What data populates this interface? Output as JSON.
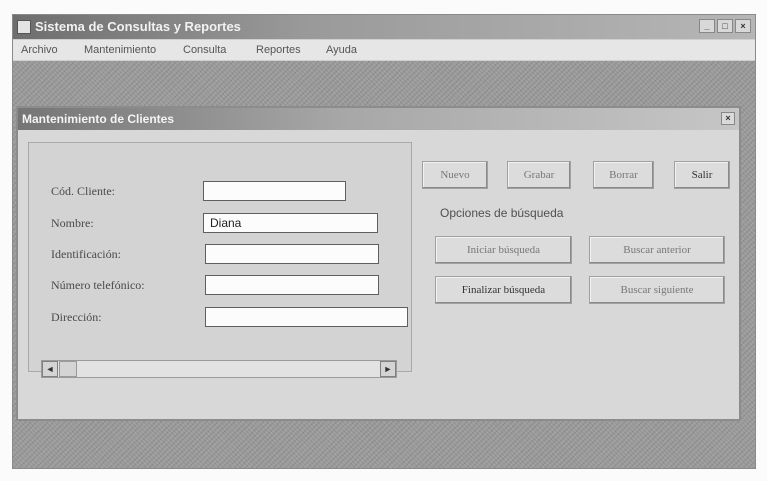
{
  "app": {
    "title": "Sistema de Consultas y Reportes",
    "controls": [
      "_",
      "□",
      "×"
    ]
  },
  "menu": [
    "Archivo",
    "Mantenimiento",
    "Consulta",
    "Reportes",
    "Ayuda"
  ],
  "child_window": {
    "title": "Mantenimiento de Clientes",
    "close": "×"
  },
  "form": {
    "labels": [
      "Cód. Cliente:",
      "Nombre:",
      "Identificación:",
      "Número telefónico:",
      "Dirección:"
    ],
    "values": [
      "",
      "Diana",
      "",
      "",
      ""
    ]
  },
  "scrollbar": {
    "left": "◄",
    "right": "►"
  },
  "actions": {
    "nuevo": "Nuevo",
    "grabar": "Grabar",
    "borrar": "Borrar",
    "salir": "Salir"
  },
  "search": {
    "title": "Opciones de búsqueda",
    "iniciar": "Iniciar búsqueda",
    "buscar_anterior": "Buscar anterior",
    "finalizar": "Finalizar búsqueda",
    "buscar_siguiente": "Buscar siguiente"
  }
}
